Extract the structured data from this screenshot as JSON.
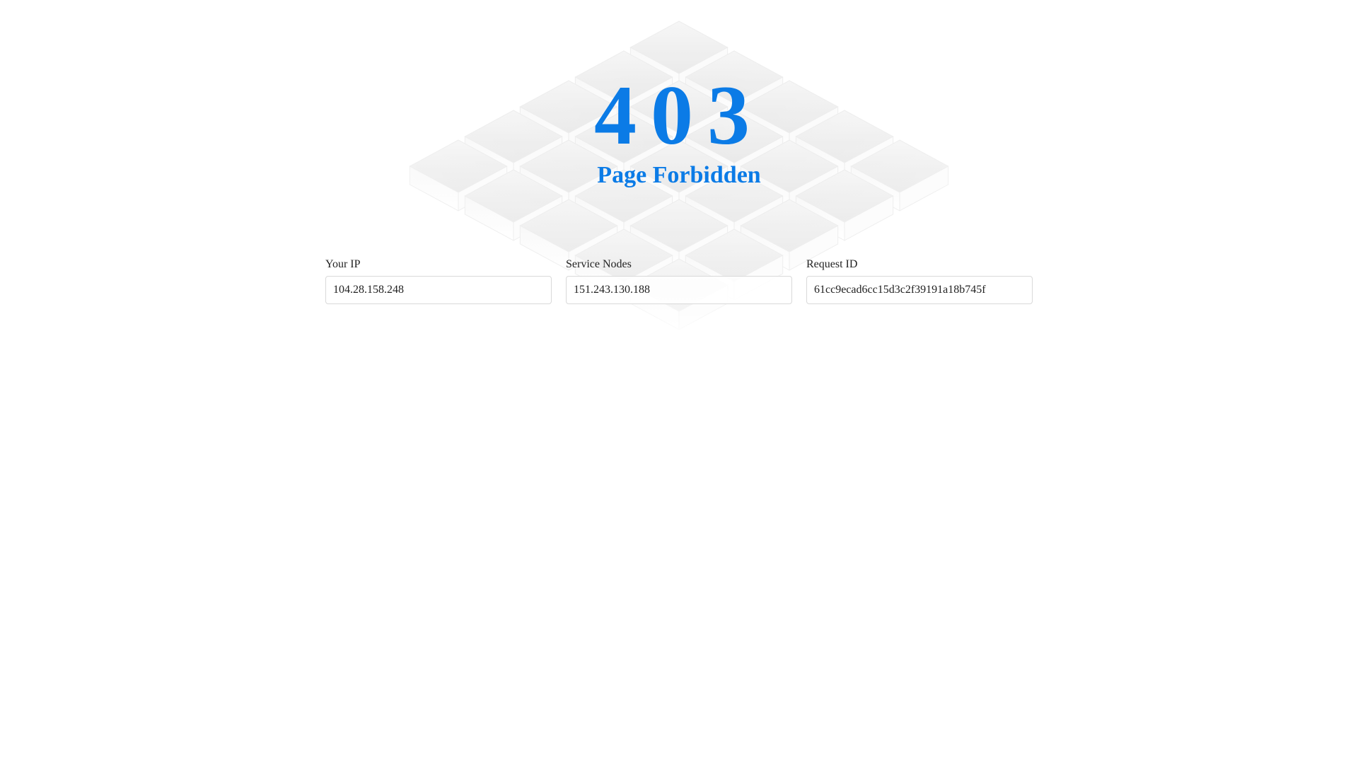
{
  "error": {
    "code": "403",
    "title": "Page Forbidden"
  },
  "fields": [
    {
      "label": "Your IP",
      "value": "104.28.158.248"
    },
    {
      "label": "Service Nodes",
      "value": "151.243.130.188"
    },
    {
      "label": "Request ID",
      "value": "61cc9ecad6cc15d3c2f39191a18b745f"
    }
  ],
  "background": {
    "icon": "server-cubes-illustration"
  },
  "colors": {
    "accent": "#0b7be6",
    "text": "#222222",
    "border": "#d9d9d9",
    "background": "#ffffff"
  }
}
